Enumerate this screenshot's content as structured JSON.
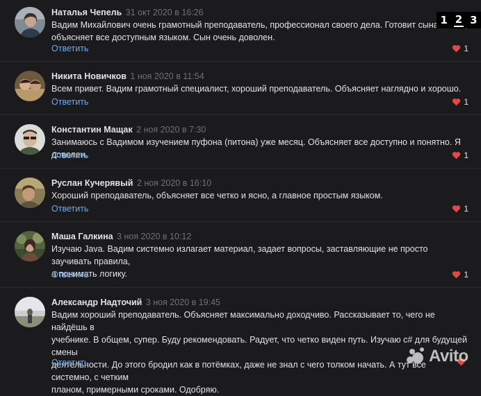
{
  "pagination": {
    "pages": [
      "1",
      "2",
      "3"
    ],
    "active_index": 1
  },
  "reply_label": "Ответить",
  "colors": {
    "background": "#1b1b1d",
    "link": "#71aaeb",
    "heart": "#e64646"
  },
  "comments": [
    {
      "author": "Наталья Чепель",
      "date": "31 окт 2020 в 16:26",
      "lines": [
        "Вадим Михайлович очень грамотный преподаватель, профессионал своего дела. Готовит сына к ОГЭ,",
        "объясняет все доступным языком. Сын очень доволен."
      ],
      "likes": "1"
    },
    {
      "author": "Никита Новичков",
      "date": "1 ноя 2020 в 11:54",
      "lines": [
        "Всем привет. Вадим грамотный специалист, хороший преподаватель. Объясняет наглядно и хорошо."
      ],
      "likes": "1"
    },
    {
      "author": "Константин Мащак",
      "date": "2 ноя 2020 в 7:30",
      "lines": [
        "Занимаюсь с Вадимом изучением пуфона (питона) уже месяц. Объясняет все доступно и понятно. Я доволен."
      ],
      "likes": "1"
    },
    {
      "author": "Руслан Кучерявый",
      "date": "2 ноя 2020 в 16:10",
      "lines": [
        "Хороший преподаватель, объясняет все четко и ясно, а главное простым языком."
      ],
      "likes": "1"
    },
    {
      "author": "Маша Галкина",
      "date": "3 ноя 2020 в 10:12",
      "lines": [
        "Изучаю Java. Вадим системно излагает материал, задает вопросы, заставляющие не просто заучивать правила,",
        "а понимать логику."
      ],
      "likes": "1"
    },
    {
      "author": "Александр Надточий",
      "date": "3 ноя 2020 в 19:45",
      "lines": [
        "Вадим хороший преподаватель. Объясняет максимально доходчиво. Рассказывает то, чего не найдёшь в",
        "учебнике. В общем, супер. Буду рекомендовать. Радует, что четко виден путь. Изучаю c# для будущей смены",
        "деятельности. До этого бродил как в потёмках, даже не знал с чего толком начать. А тут все системно, с четким",
        "планом, примерными сроками. Одобряю."
      ],
      "likes": ""
    }
  ],
  "watermark": {
    "text": "Avito",
    "icon": "avito-logo-icon"
  }
}
